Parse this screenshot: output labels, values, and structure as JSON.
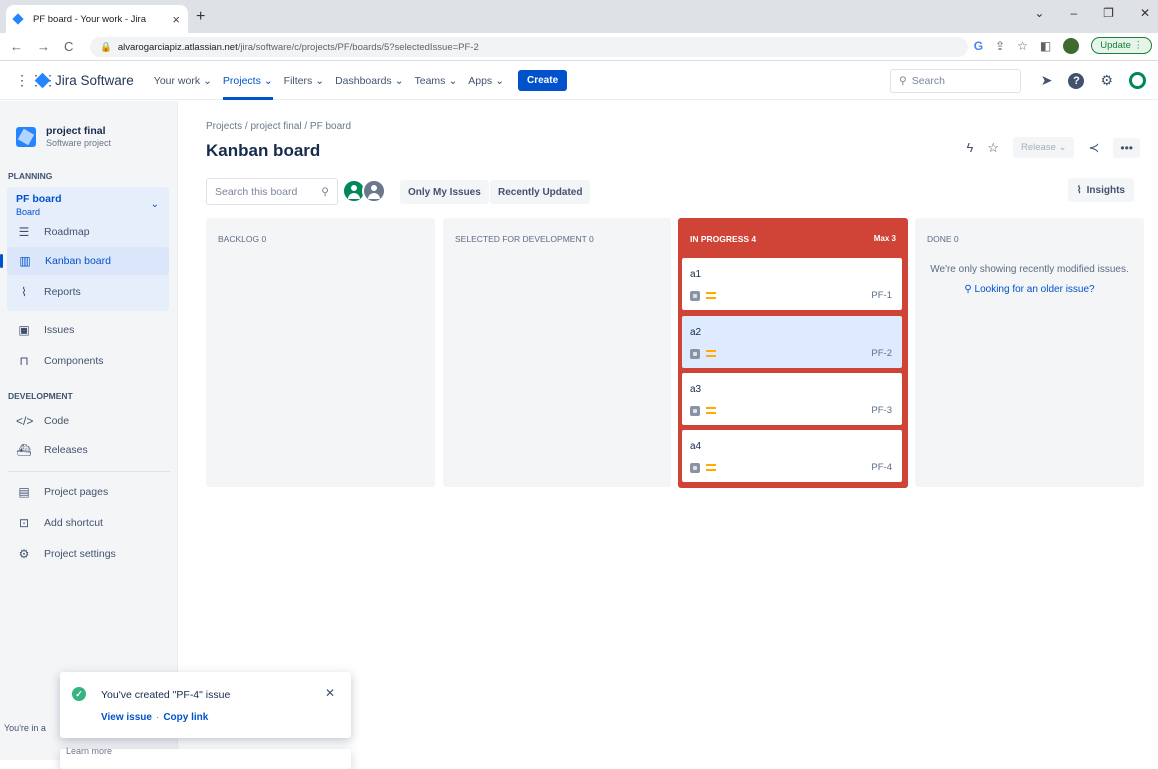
{
  "browser": {
    "tab_title": "PF board - Your work - Jira",
    "url_domain": "alvarogarciapiz.atlassian.net",
    "url_path": "/jira/software/c/projects/PF/boards/5?selectedIssue=PF-2",
    "update_label": "Update"
  },
  "topnav": {
    "product": "Jira Software",
    "menu": [
      "Your work",
      "Projects",
      "Filters",
      "Dashboards",
      "Teams",
      "Apps"
    ],
    "create": "Create",
    "search_placeholder": "Search"
  },
  "sidebar": {
    "project_name": "project final",
    "project_type": "Software project",
    "planning_heading": "PLANNING",
    "board_name": "PF board",
    "board_sub": "Board",
    "items": [
      "Roadmap",
      "Kanban board",
      "Reports",
      "Issues",
      "Components"
    ],
    "development_heading": "DEVELOPMENT",
    "dev_items": [
      "Code",
      "Releases"
    ],
    "bottom_items": [
      "Project pages",
      "Add shortcut",
      "Project settings"
    ],
    "footer_text": "You're in a",
    "footer_learn": "Learn more"
  },
  "board": {
    "breadcrumb": "Projects  /  project final  /  PF board",
    "title": "Kanban board",
    "release_label": "Release",
    "search_placeholder": "Search this board",
    "filter_only_mine": "Only My Issues",
    "filter_recent": "Recently Updated",
    "insights": "Insights",
    "columns": {
      "backlog": "BACKLOG 0",
      "selected": "SELECTED FOR DEVELOPMENT 0",
      "in_progress": "IN PROGRESS 4",
      "in_progress_max": "Max 3",
      "done": "DONE 0"
    },
    "cards": [
      {
        "title": "a1",
        "key": "PF-1"
      },
      {
        "title": "a2",
        "key": "PF-2"
      },
      {
        "title": "a3",
        "key": "PF-3"
      },
      {
        "title": "a4",
        "key": "PF-4"
      }
    ],
    "done_info": "We're only showing recently modified issues.",
    "done_link": "Looking for an older issue?"
  },
  "flag": {
    "message": "You've created \"PF-4\" issue",
    "view_issue": "View issue",
    "copy_link": "Copy link"
  }
}
